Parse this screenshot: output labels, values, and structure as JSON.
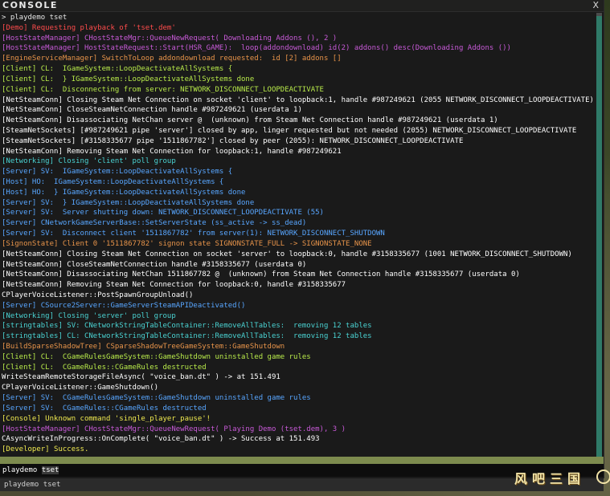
{
  "window": {
    "title": "CONSOLE",
    "close_label": "X"
  },
  "console_input": {
    "typed": "playdemo ",
    "selected_completion": "tset"
  },
  "autocomplete": {
    "suggestion": "playdemo tset"
  },
  "watermark": {
    "text": "风吧三国"
  },
  "colors": {
    "white": "#ffffff",
    "red": "#ff4c4c",
    "magenta": "#c85ad8",
    "orange": "#e8944a",
    "lime": "#b8ea4a",
    "blue": "#58a6ff",
    "cyan": "#4ad2d2",
    "yellow": "#f0ea50",
    "scrollbar_thumb": "#2f7a68",
    "input_bar": "#7d8b4e"
  },
  "log_lines": [
    {
      "text": "> playdemo tset",
      "color": "#e6e6e6"
    },
    {
      "text": "[Demo] Requesting playback of 'tset.dem'",
      "color": "#ff4c4c"
    },
    {
      "text": "[HostStateManager] CHostStateMgr::QueueNewRequest( Downloading Addons (), 2 )",
      "color": "#c85ad8"
    },
    {
      "text": "[HostStateManager] HostStateRequest::Start(HSR_GAME):  loop(addondownload) id(2) addons() desc(Downloading Addons ())",
      "color": "#c85ad8"
    },
    {
      "text": "[EngineServiceManager] SwitchToLoop addondownload requested:  id [2] addons []",
      "color": "#e8944a"
    },
    {
      "text": "[Client] CL:  IGameSystem::LoopDeactivateAllSystems {",
      "color": "#b8ea4a"
    },
    {
      "text": "[Client] CL:  } IGameSystem::LoopDeactivateAllSystems done",
      "color": "#b8ea4a"
    },
    {
      "text": "[Client] CL:  Disconnecting from server: NETWORK_DISCONNECT_LOOPDEACTIVATE",
      "color": "#b8ea4a"
    },
    {
      "text": "[NetSteamConn] Closing Steam Net Connection on socket 'client' to loopback:1, handle #987249621 (2055 NETWORK_DISCONNECT_LOOPDEACTIVATE)",
      "color": "#ffffff"
    },
    {
      "text": "[NetSteamConn] CloseSteamNetConnection handle #987249621 (userdata 1)",
      "color": "#ffffff"
    },
    {
      "text": "[NetSteamConn] Disassociating NetChan server @  (unknown) from Steam Net Connection handle #987249621 (userdata 1)",
      "color": "#ffffff"
    },
    {
      "text": "[SteamNetSockets] [#987249621 pipe 'server'] closed by app, linger requested but not needed (2055) NETWORK_DISCONNECT_LOOPDEACTIVATE",
      "color": "#ffffff"
    },
    {
      "text": "[SteamNetSockets] [#3158335677 pipe '1511867782'] closed by peer (2055): NETWORK_DISCONNECT_LOOPDEACTIVATE",
      "color": "#ffffff"
    },
    {
      "text": "[NetSteamConn] Removing Steam Net Connection for loopback:1, handle #987249621",
      "color": "#ffffff"
    },
    {
      "text": "[Networking] Closing 'client' poll group",
      "color": "#4ad2d2"
    },
    {
      "text": "[Server] SV:  IGameSystem::LoopDeactivateAllSystems {",
      "color": "#58a6ff"
    },
    {
      "text": "[Host] HO:  IGameSystem::LoopDeactivateAllSystems {",
      "color": "#58a6ff"
    },
    {
      "text": "[Host] HO:  } IGameSystem::LoopDeactivateAllSystems done",
      "color": "#58a6ff"
    },
    {
      "text": "[Server] SV:  } IGameSystem::LoopDeactivateAllSystems done",
      "color": "#58a6ff"
    },
    {
      "text": "[Server] SV:  Server shutting down: NETWORK_DISCONNECT_LOOPDEACTIVATE (55)",
      "color": "#58a6ff"
    },
    {
      "text": "[Server] CNetworkGameServerBase::SetServerState (ss_active -> ss_dead)",
      "color": "#58a6ff"
    },
    {
      "text": "[Server] SV:  Disconnect client '1511867782' from server(1): NETWORK_DISCONNECT_SHUTDOWN",
      "color": "#58a6ff"
    },
    {
      "text": "[SignonState] Client 0 '1511867782' signon state SIGNONSTATE_FULL -> SIGNONSTATE_NONE",
      "color": "#e8944a"
    },
    {
      "text": "[NetSteamConn] Closing Steam Net Connection on socket 'server' to loopback:0, handle #3158335677 (1001 NETWORK_DISCONNECT_SHUTDOWN)",
      "color": "#ffffff"
    },
    {
      "text": "[NetSteamConn] CloseSteamNetConnection handle #3158335677 (userdata 0)",
      "color": "#ffffff"
    },
    {
      "text": "[NetSteamConn] Disassociating NetChan 1511867782 @  (unknown) from Steam Net Connection handle #3158335677 (userdata 0)",
      "color": "#ffffff"
    },
    {
      "text": "[NetSteamConn] Removing Steam Net Connection for loopback:0, handle #3158335677",
      "color": "#ffffff"
    },
    {
      "text": "CPlayerVoiceListener::PostSpawnGroupUnload()",
      "color": "#ffffff"
    },
    {
      "text": "[Server] CSource2Server::GameServerSteamAPIDeactivated()",
      "color": "#58a6ff"
    },
    {
      "text": "[Networking] Closing 'server' poll group",
      "color": "#4ad2d2"
    },
    {
      "text": "[stringtables] SV: CNetworkStringTableContainer::RemoveAllTables:  removing 12 tables",
      "color": "#4ad2d2"
    },
    {
      "text": "[stringtables] CL: CNetworkStringTableContainer::RemoveAllTables:  removing 12 tables",
      "color": "#4ad2d2"
    },
    {
      "text": "[BuildSparseShadowTree] CSparseShadowTreeGameSystem::GameShutdown",
      "color": "#e8944a"
    },
    {
      "text": "[Client] CL:  CGameRulesGameSystem::GameShutdown uninstalled game rules",
      "color": "#b8ea4a"
    },
    {
      "text": "[Client] CL:  CGameRules::CGameRules destructed",
      "color": "#b8ea4a"
    },
    {
      "text": "WriteSteamRemoteStorageFileAsync( \"voice_ban.dt\" ) -> at 151.491",
      "color": "#ffffff"
    },
    {
      "text": "CPlayerVoiceListener::GameShutdown()",
      "color": "#ffffff"
    },
    {
      "text": "[Server] SV:  CGameRulesGameSystem::GameShutdown uninstalled game rules",
      "color": "#58a6ff"
    },
    {
      "text": "[Server] SV:  CGameRules::CGameRules destructed",
      "color": "#58a6ff"
    },
    {
      "text": "[Console] Unknown command 'single_player_pause'!",
      "color": "#f0ea50"
    },
    {
      "text": "[HostStateManager] CHostStateMgr::QueueNewRequest( Playing Demo (tset.dem), 3 )",
      "color": "#c85ad8"
    },
    {
      "text": "CAsyncWriteInProgress::OnComplete( \"voice_ban.dt\" ) -> Success at 151.493",
      "color": "#ffffff"
    },
    {
      "text": "[Developer] Success.",
      "color": "#f0ea50"
    }
  ]
}
